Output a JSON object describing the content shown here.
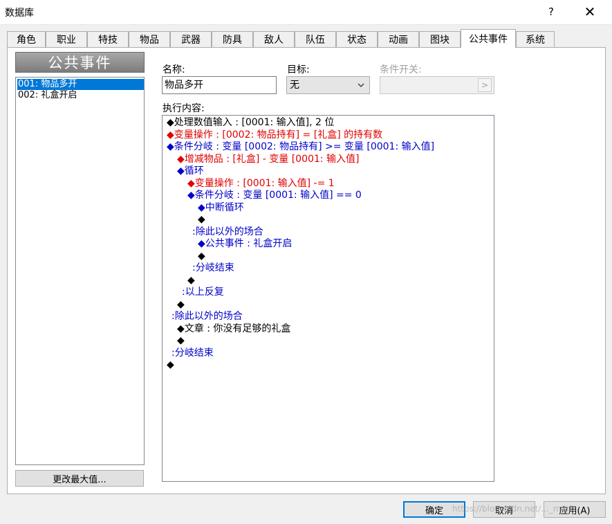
{
  "window": {
    "title": "数据库",
    "help_glyph": "?",
    "close_glyph": "✕"
  },
  "tabs": [
    {
      "label": "角色"
    },
    {
      "label": "职业"
    },
    {
      "label": "特技"
    },
    {
      "label": "物品"
    },
    {
      "label": "武器"
    },
    {
      "label": "防具"
    },
    {
      "label": "敌人"
    },
    {
      "label": "队伍"
    },
    {
      "label": "状态"
    },
    {
      "label": "动画"
    },
    {
      "label": "图块"
    },
    {
      "label": "公共事件",
      "active": true
    },
    {
      "label": "系统"
    }
  ],
  "left_panel": {
    "header": "公共事件",
    "items": [
      {
        "label": "001: 物品多开",
        "selected": true
      },
      {
        "label": "002: 礼盒开启",
        "selected": false
      }
    ],
    "change_max_button": "更改最大值..."
  },
  "form": {
    "name_label": "名称:",
    "name_value": "物品多开",
    "target_label": "目标:",
    "target_value": "无",
    "switch_label": "条件开关:",
    "switch_button_glyph": ">",
    "content_label": "执行内容:"
  },
  "commands": [
    {
      "indent": 0,
      "color": "black",
      "text": "◆处理数值输入 : [0001: 输入值], 2 位"
    },
    {
      "indent": 0,
      "color": "red",
      "text": "◆变量操作 : [0002: 物品持有] = [礼盒] 的持有数"
    },
    {
      "indent": 0,
      "color": "blue",
      "text": "◆条件分岐 : 变量 [0002: 物品持有] >= 变量 [0001: 输入值]"
    },
    {
      "indent": 1,
      "color": "red",
      "text": "◆增减物品 : [礼盒] - 变量 [0001: 输入值]"
    },
    {
      "indent": 1,
      "color": "blue",
      "text": "◆循环"
    },
    {
      "indent": 2,
      "color": "red",
      "text": "◆变量操作 : [0001: 输入值] -= 1"
    },
    {
      "indent": 2,
      "color": "blue",
      "text": "◆条件分岐 : 变量 [0001: 输入值] == 0"
    },
    {
      "indent": 3,
      "color": "blue",
      "text": "◆中断循环"
    },
    {
      "indent": 3,
      "color": "black",
      "text": "◆"
    },
    {
      "indent": 2,
      "color": "blue",
      "text": ":除此以外的场合"
    },
    {
      "indent": 3,
      "color": "blue",
      "text": "◆公共事件 : 礼盒开启"
    },
    {
      "indent": 3,
      "color": "black",
      "text": "◆"
    },
    {
      "indent": 2,
      "color": "blue",
      "text": ":分岐结束"
    },
    {
      "indent": 2,
      "color": "black",
      "text": "◆"
    },
    {
      "indent": 1,
      "color": "blue",
      "text": ":以上反复"
    },
    {
      "indent": 1,
      "color": "black",
      "text": "◆"
    },
    {
      "indent": 0,
      "color": "blue",
      "text": ":除此以外的场合"
    },
    {
      "indent": 1,
      "color": "black",
      "text": "◆文章 : 你没有足够的礼盒"
    },
    {
      "indent": 1,
      "color": "black",
      "text": "◆"
    },
    {
      "indent": 0,
      "color": "blue",
      "text": ":分岐结束"
    },
    {
      "indent": 0,
      "color": "black",
      "text": "◆"
    }
  ],
  "buttons": {
    "ok": "确定",
    "cancel": "取消",
    "apply": "应用(A)"
  },
  "watermark": "https://blog.csdn.net/..._mark",
  "colors": {
    "accent": "#0078d7",
    "command_black": "#000000",
    "command_red": "#e00000",
    "command_blue": "#0000cc"
  }
}
